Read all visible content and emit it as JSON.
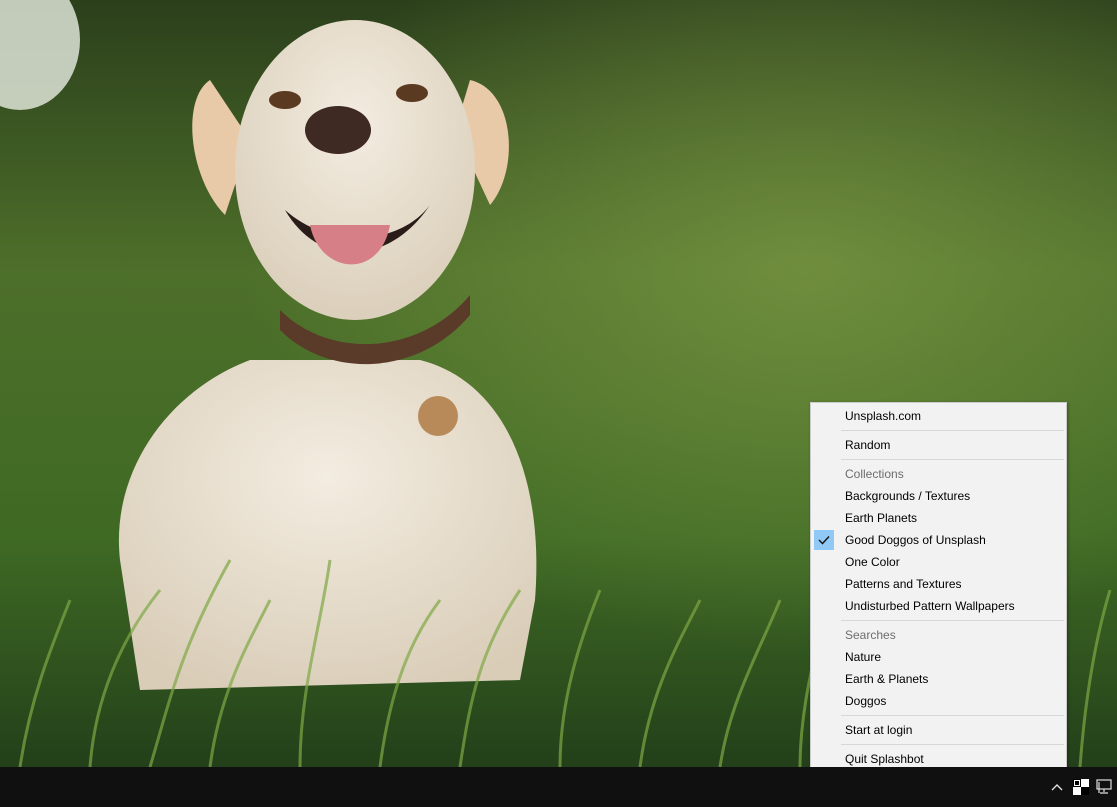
{
  "menu": {
    "items": [
      {
        "type": "item",
        "label": "Unsplash.com"
      },
      {
        "type": "separator"
      },
      {
        "type": "item",
        "label": "Random"
      },
      {
        "type": "separator"
      },
      {
        "type": "header",
        "label": "Collections"
      },
      {
        "type": "item",
        "label": "Backgrounds / Textures"
      },
      {
        "type": "item",
        "label": "Earth Planets"
      },
      {
        "type": "item",
        "label": "Good Doggos of Unsplash",
        "checked": true
      },
      {
        "type": "item",
        "label": "One Color"
      },
      {
        "type": "item",
        "label": "Patterns and Textures"
      },
      {
        "type": "item",
        "label": "Undisturbed Pattern Wallpapers"
      },
      {
        "type": "separator"
      },
      {
        "type": "header",
        "label": "Searches"
      },
      {
        "type": "item",
        "label": "Nature"
      },
      {
        "type": "item",
        "label": "Earth & Planets"
      },
      {
        "type": "item",
        "label": "Doggos"
      },
      {
        "type": "separator"
      },
      {
        "type": "item",
        "label": "Start at login"
      },
      {
        "type": "separator"
      },
      {
        "type": "item",
        "label": "Quit Splashbot"
      }
    ]
  },
  "taskbar": {
    "tray_icons": [
      "chevron-up-icon",
      "splashbot-tray-icon",
      "network-icon"
    ]
  },
  "colors": {
    "menu_background": "#f2f2f2",
    "checked_highlight": "#90c8f6",
    "taskbar": "#101010"
  }
}
